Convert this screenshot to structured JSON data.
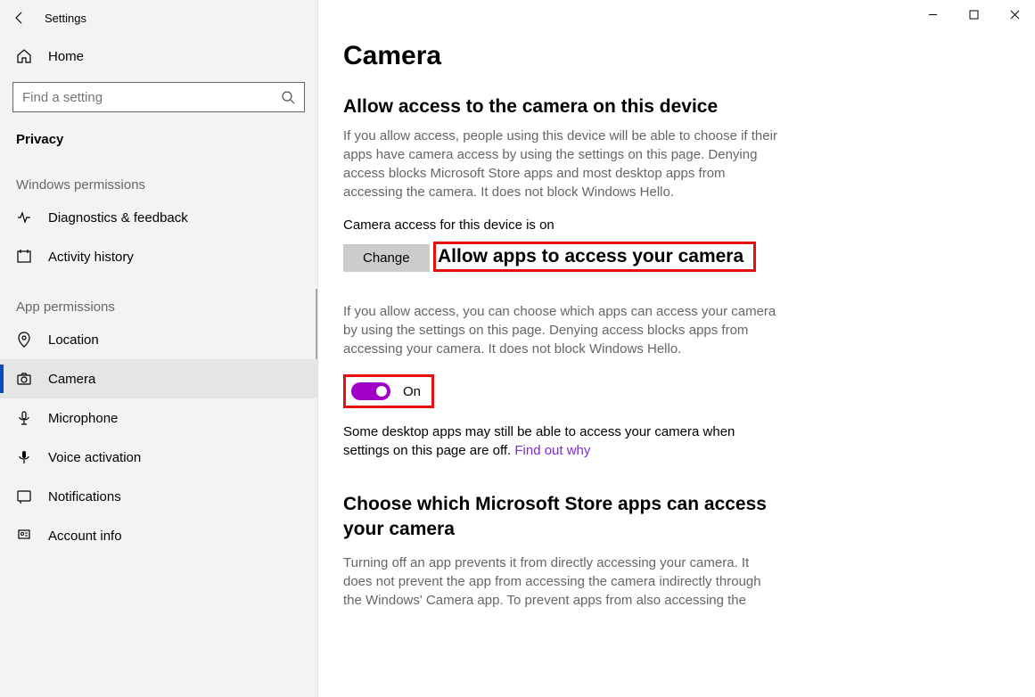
{
  "window": {
    "title": "Settings",
    "controls": {
      "minimize": "min",
      "maximize": "max",
      "close": "close"
    }
  },
  "sidebar": {
    "home": "Home",
    "search_placeholder": "Find a setting",
    "section": "Privacy",
    "groups": [
      {
        "label": "Windows permissions",
        "items": [
          {
            "icon": "diagnostics",
            "label": "Diagnostics & feedback"
          },
          {
            "icon": "activity",
            "label": "Activity history"
          }
        ]
      },
      {
        "label": "App permissions",
        "items": [
          {
            "icon": "location",
            "label": "Location"
          },
          {
            "icon": "camera",
            "label": "Camera",
            "active": true
          },
          {
            "icon": "microphone",
            "label": "Microphone"
          },
          {
            "icon": "voice",
            "label": "Voice activation"
          },
          {
            "icon": "notifications",
            "label": "Notifications"
          },
          {
            "icon": "account",
            "label": "Account info"
          }
        ]
      }
    ]
  },
  "main": {
    "title": "Camera",
    "section1": {
      "heading": "Allow access to the camera on this device",
      "desc": "If you allow access, people using this device will be able to choose if their apps have camera access by using the settings on this page. Denying access blocks Microsoft Store apps and most desktop apps from accessing the camera. It does not block Windows Hello.",
      "status": "Camera access for this device is on",
      "change_button": "Change"
    },
    "section2": {
      "heading": "Allow apps to access your camera",
      "desc": "If you allow access, you can choose which apps can access your camera by using the settings on this page. Denying access blocks apps from accessing your camera. It does not block Windows Hello.",
      "toggle_state": "On",
      "note_prefix": "Some desktop apps may still be able to access your camera when settings on this page are off. ",
      "note_link": "Find out why"
    },
    "section3": {
      "heading": "Choose which Microsoft Store apps can access your camera",
      "desc": "Turning off an app prevents it from directly accessing your camera. It does not prevent the app from accessing the camera indirectly through the Windows' Camera app. To prevent apps from also accessing the"
    }
  },
  "annotations": {
    "highlight_heading": true,
    "highlight_toggle": true
  }
}
